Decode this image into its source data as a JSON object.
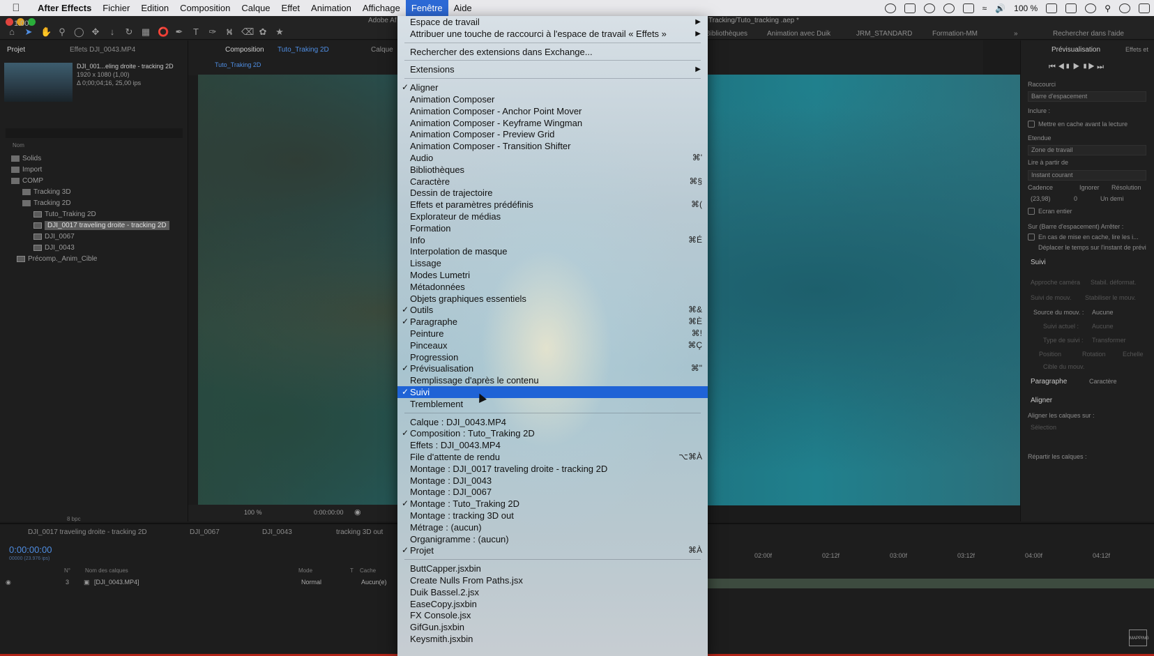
{
  "menubar": {
    "app_name": "After Effects",
    "items": [
      "Fichier",
      "Edition",
      "Composition",
      "Calque",
      "Effet",
      "Animation",
      "Affichage",
      "Fenêtre",
      "Aide"
    ],
    "active": "Fenêtre",
    "battery": "100 %"
  },
  "window": {
    "title_left": "Adobe Af",
    "title_right": "Tracking/Tuto_tracking .aep *",
    "version": "1.00"
  },
  "workspaces": [
    "Bibliothèques",
    "Animation avec Duik",
    "JRM_STANDARD",
    "Formation-MM"
  ],
  "search_help": "Rechercher dans l'aide",
  "project": {
    "tab_project": "Projet",
    "tab_effects": "Effets DJI_0043.MP4",
    "selected_name": "DJI_001...eling droite - tracking 2D",
    "resolution": "1920 x 1080 (1,00)",
    "duration": "Δ 0;00;04;16, 25,00 ips",
    "col_name": "Nom",
    "bit_depth": "8 bpc",
    "tree": [
      {
        "label": "Solids",
        "indent": 0,
        "type": "folder"
      },
      {
        "label": "Import",
        "indent": 0,
        "type": "folder"
      },
      {
        "label": "COMP",
        "indent": 0,
        "type": "folder"
      },
      {
        "label": "Tracking 3D",
        "indent": 1,
        "type": "folder"
      },
      {
        "label": "Tracking 2D",
        "indent": 1,
        "type": "folder"
      },
      {
        "label": "Tuto_Traking 2D",
        "indent": 2,
        "type": "comp"
      },
      {
        "label": "DJI_0017 traveling droite - tracking 2D",
        "indent": 2,
        "type": "comp",
        "selected": true
      },
      {
        "label": "DJI_0067",
        "indent": 2,
        "type": "comp"
      },
      {
        "label": "DJI_0043",
        "indent": 2,
        "type": "comp"
      },
      {
        "label": "Précomp._Anim_Cible",
        "indent": 1,
        "type": "comp"
      }
    ]
  },
  "composition": {
    "tab_label": "Composition",
    "comp_name": "Tuto_Traking 2D",
    "tab_calque": "Calque",
    "breadcrumb": "Tuto_Traking 2D",
    "zoom": "100 %",
    "time": "0:00:00:00"
  },
  "right_panel": {
    "preview_tab": "Prévisualisation",
    "effects_tab": "Effets et",
    "raccourci": "Raccourci",
    "raccourci_val": "Barre d'espacement",
    "inclure": "Inclure :",
    "cache_before": "Mettre en cache avant la lecture",
    "etendue": "Etendue",
    "etendue_val": "Zone de travail",
    "lire": "Lire à partir de",
    "lire_val": "Instant courant",
    "cadence": "Cadence",
    "ignorer": "Ignorer",
    "resolution": "Résolution",
    "cadence_val": "(23,98)",
    "ignorer_val": "0",
    "resolution_val": "Un demi",
    "plein": "Ecran entier",
    "sur_barre": "Sur (Barre d'espacement) Arrêter :",
    "en_cas": "En cas de mise en cache, lire les i...",
    "deplacer": "Déplacer le temps sur l'instant de prévi",
    "suivi": "Suivi",
    "approche": "Approche caméra",
    "stabil": "Stabil. déformat.",
    "suivi_mouv": "Suivi de mouv.",
    "stabiliser": "Stabiliser le mouv.",
    "source": "Source du mouv. :",
    "source_val": "Aucune",
    "suivi_actuel": "Suivi actuel :",
    "suivi_actuel_val": "Aucune",
    "type_suivi": "Type de suivi :",
    "type_suivi_val": "Transformer",
    "position": "Position",
    "rotation": "Rotation",
    "echelle": "Echelle",
    "cible": "Cible du mouv.",
    "paragraphe": "Paragraphe",
    "caractere": "Caractère",
    "aligner": "Aligner",
    "aligner_sur": "Aligner les calques sur :",
    "selection": "Sélection",
    "repartir": "Répartir les calques :"
  },
  "timeline": {
    "tabs": [
      "DJI_0017 traveling droite - tracking 2D",
      "DJI_0067",
      "DJI_0043",
      "tracking 3D out"
    ],
    "timecode": "0:00:00:00",
    "fps": "00000 (23.976 ips)",
    "col_num": "N°",
    "col_layers": "Nom des calques",
    "col_mode": "Mode",
    "col_t": "T",
    "col_cache": "Cache",
    "layer_num": "3",
    "layer_name": "[DJI_0043.MP4]",
    "layer_mode": "Normal",
    "layer_cache": "Aucun(e)",
    "ruler": [
      "02:00f",
      "02:12f",
      "03:00f",
      "03:12f",
      "04:00f",
      "04:12f"
    ]
  },
  "menu": {
    "items": [
      {
        "label": "Espace de travail",
        "submenu": true
      },
      {
        "label": "Attribuer une touche de raccourci à l'espace de travail « Effets »",
        "submenu": true
      },
      {
        "sep": true
      },
      {
        "label": "Rechercher des extensions dans Exchange..."
      },
      {
        "sep": true
      },
      {
        "label": "Extensions",
        "submenu": true
      },
      {
        "sep": true
      },
      {
        "label": "Aligner",
        "checked": true
      },
      {
        "label": "Animation Composer"
      },
      {
        "label": "Animation Composer - Anchor Point Mover"
      },
      {
        "label": "Animation Composer - Keyframe Wingman"
      },
      {
        "label": "Animation Composer - Preview Grid"
      },
      {
        "label": "Animation Composer - Transition Shifter"
      },
      {
        "label": "Audio",
        "shortcut": "⌘'"
      },
      {
        "label": "Bibliothèques"
      },
      {
        "label": "Caractère",
        "shortcut": "⌘§"
      },
      {
        "label": "Dessin de trajectoire"
      },
      {
        "label": "Effets et paramètres prédéfinis",
        "shortcut": "⌘("
      },
      {
        "label": "Explorateur de médias"
      },
      {
        "label": "Formation"
      },
      {
        "label": "Info",
        "shortcut": "⌘É"
      },
      {
        "label": "Interpolation de masque"
      },
      {
        "label": "Lissage"
      },
      {
        "label": "Modes Lumetri"
      },
      {
        "label": "Métadonnées"
      },
      {
        "label": "Objets graphiques essentiels"
      },
      {
        "label": "Outils",
        "checked": true,
        "shortcut": "⌘&"
      },
      {
        "label": "Paragraphe",
        "checked": true,
        "shortcut": "⌘È"
      },
      {
        "label": "Peinture",
        "shortcut": "⌘!"
      },
      {
        "label": "Pinceaux",
        "shortcut": "⌘Ç"
      },
      {
        "label": "Progression"
      },
      {
        "label": "Prévisualisation",
        "checked": true,
        "shortcut": "⌘\""
      },
      {
        "label": "Remplissage d'après le contenu"
      },
      {
        "label": "Suivi",
        "checked": true,
        "highlighted": true
      },
      {
        "label": "Tremblement"
      },
      {
        "sep": true
      },
      {
        "label": "Calque : DJI_0043.MP4"
      },
      {
        "label": "Composition : Tuto_Traking 2D",
        "checked": true
      },
      {
        "label": "Effets : DJI_0043.MP4"
      },
      {
        "label": "File d'attente de rendu",
        "shortcut": "⌥⌘À"
      },
      {
        "label": "Montage : DJI_0017 traveling droite - tracking 2D"
      },
      {
        "label": "Montage : DJI_0043"
      },
      {
        "label": "Montage : DJI_0067"
      },
      {
        "label": "Montage : Tuto_Traking 2D",
        "checked": true
      },
      {
        "label": "Montage : tracking 3D out"
      },
      {
        "label": "Métrage : (aucun)"
      },
      {
        "label": "Organigramme : (aucun)"
      },
      {
        "label": "Projet",
        "checked": true,
        "shortcut": "⌘À"
      },
      {
        "sep": true
      },
      {
        "label": "ButtCapper.jsxbin"
      },
      {
        "label": "Create Nulls From Paths.jsx"
      },
      {
        "label": "Duik Bassel.2.jsx"
      },
      {
        "label": "EaseCopy.jsxbin"
      },
      {
        "label": "FX Console.jsx"
      },
      {
        "label": "GifGun.jsxbin"
      },
      {
        "label": "Keysmith.jsxbin"
      }
    ]
  },
  "watermark": "MAPPING"
}
